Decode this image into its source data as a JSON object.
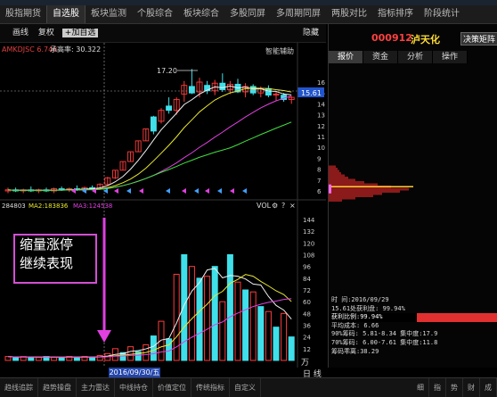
{
  "tabs": [
    {
      "label": "股指期货",
      "active": false
    },
    {
      "label": "自选股",
      "active": true
    },
    {
      "label": "板块监测",
      "active": false
    },
    {
      "label": "个股综合",
      "active": false
    },
    {
      "label": "板块综合",
      "active": false
    },
    {
      "label": "多股同屏",
      "active": false
    },
    {
      "label": "多周期同屏",
      "active": false
    },
    {
      "label": "两股对比",
      "active": false
    },
    {
      "label": "指标排序",
      "active": false
    },
    {
      "label": "阶段统计",
      "active": false
    }
  ],
  "toolbar": {
    "draw_label": "画线",
    "reset_label": "复权",
    "add_fav_label": "+加自选",
    "hide_label": "隐藏",
    "indicator_line": "AMKDJSC 6.746",
    "win_rate": "承高率: 30.322",
    "assist_label": "智能辅助"
  },
  "price_axis": {
    "ticks": [
      "16",
      "15",
      "14",
      "13",
      "12",
      "11",
      "10",
      "9",
      "8",
      "7",
      "6"
    ],
    "current_price": "15.61",
    "peak_label": "17.20"
  },
  "volume": {
    "vol_label": "VOL",
    "ma1": "284803",
    "ma2": "MA2:183836",
    "ma3": "MA3:124538",
    "ticks": [
      "144",
      "132",
      "120",
      "108",
      "96",
      "84",
      "72",
      "60",
      "48",
      "36",
      "24",
      "12"
    ],
    "unit_top": "万",
    "unit_bottom": "日 线"
  },
  "candles": [
    {
      "o": 6.0,
      "h": 6.3,
      "l": 5.8,
      "c": 6.1,
      "up": true
    },
    {
      "o": 6.1,
      "h": 6.3,
      "l": 5.9,
      "c": 6.0,
      "up": false
    },
    {
      "o": 6.0,
      "h": 6.2,
      "l": 5.8,
      "c": 6.1,
      "up": true
    },
    {
      "o": 6.1,
      "h": 6.4,
      "l": 5.9,
      "c": 6.0,
      "up": false
    },
    {
      "o": 6.0,
      "h": 6.2,
      "l": 5.8,
      "c": 6.1,
      "up": true
    },
    {
      "o": 6.1,
      "h": 6.3,
      "l": 5.9,
      "c": 6.0,
      "up": false
    },
    {
      "o": 6.0,
      "h": 6.3,
      "l": 5.8,
      "c": 6.2,
      "up": true
    },
    {
      "o": 6.2,
      "h": 6.4,
      "l": 6.0,
      "c": 6.1,
      "up": false
    },
    {
      "o": 6.1,
      "h": 6.3,
      "l": 5.9,
      "c": 6.2,
      "up": true
    },
    {
      "o": 6.2,
      "h": 6.5,
      "l": 6.0,
      "c": 6.1,
      "up": false
    },
    {
      "o": 6.1,
      "h": 6.4,
      "l": 6.0,
      "c": 6.3,
      "up": true
    },
    {
      "o": 6.3,
      "h": 6.5,
      "l": 6.1,
      "c": 6.2,
      "up": false
    },
    {
      "o": 6.2,
      "h": 6.7,
      "l": 6.1,
      "c": 6.6,
      "up": true
    },
    {
      "o": 6.6,
      "h": 7.3,
      "l": 6.5,
      "c": 7.2,
      "up": true
    },
    {
      "o": 7.2,
      "h": 7.9,
      "l": 7.1,
      "c": 7.9,
      "up": true
    },
    {
      "o": 7.9,
      "h": 8.7,
      "l": 7.9,
      "c": 8.7,
      "up": true
    },
    {
      "o": 8.7,
      "h": 9.6,
      "l": 8.7,
      "c": 9.6,
      "up": true
    },
    {
      "o": 9.6,
      "h": 10.6,
      "l": 9.6,
      "c": 10.6,
      "up": true
    },
    {
      "o": 10.6,
      "h": 11.7,
      "l": 10.6,
      "c": 11.7,
      "up": true
    },
    {
      "o": 11.5,
      "h": 12.9,
      "l": 11.2,
      "c": 12.8,
      "up": false
    },
    {
      "o": 12.4,
      "h": 13.6,
      "l": 12.2,
      "c": 13.4,
      "up": true
    },
    {
      "o": 13.8,
      "h": 14.6,
      "l": 13.1,
      "c": 13.4,
      "up": false
    },
    {
      "o": 13.4,
      "h": 14.6,
      "l": 13.0,
      "c": 14.4,
      "up": true
    },
    {
      "o": 14.9,
      "h": 16.1,
      "l": 14.2,
      "c": 15.7,
      "up": true
    },
    {
      "o": 15.6,
      "h": 17.2,
      "l": 14.9,
      "c": 15.0,
      "up": false
    },
    {
      "o": 15.1,
      "h": 16.4,
      "l": 14.6,
      "c": 16.0,
      "up": true
    },
    {
      "o": 15.7,
      "h": 16.1,
      "l": 14.9,
      "c": 15.2,
      "up": false
    },
    {
      "o": 15.2,
      "h": 16.2,
      "l": 14.8,
      "c": 15.9,
      "up": true
    },
    {
      "o": 15.9,
      "h": 16.8,
      "l": 15.1,
      "c": 15.3,
      "up": false
    },
    {
      "o": 15.3,
      "h": 16.1,
      "l": 14.9,
      "c": 15.8,
      "up": true
    },
    {
      "o": 15.8,
      "h": 16.3,
      "l": 15.0,
      "c": 15.1,
      "up": false
    },
    {
      "o": 15.1,
      "h": 15.9,
      "l": 14.6,
      "c": 15.6,
      "up": true
    },
    {
      "o": 15.6,
      "h": 15.8,
      "l": 14.8,
      "c": 15.0,
      "up": false
    },
    {
      "o": 15.0,
      "h": 15.6,
      "l": 14.6,
      "c": 15.4,
      "up": true
    },
    {
      "o": 15.4,
      "h": 15.7,
      "l": 14.6,
      "c": 14.8,
      "up": false
    },
    {
      "o": 14.8,
      "h": 15.1,
      "l": 14.3,
      "c": 14.9,
      "up": true
    },
    {
      "o": 14.8,
      "h": 15.0,
      "l": 14.2,
      "c": 14.4,
      "up": false
    },
    {
      "o": 14.4,
      "h": 14.7,
      "l": 14.0,
      "c": 14.6,
      "up": true
    }
  ],
  "volumes": [
    4,
    3,
    4,
    3,
    3,
    4,
    3,
    3,
    4,
    3,
    4,
    3,
    5,
    7,
    12,
    8,
    14,
    9,
    16,
    25,
    40,
    22,
    88,
    108,
    96,
    84,
    86,
    96,
    60,
    108,
    80,
    72,
    70,
    55,
    50,
    34,
    48,
    24
  ],
  "volume_color": [
    "r",
    "c",
    "r",
    "c",
    "r",
    "c",
    "r",
    "c",
    "r",
    "c",
    "r",
    "c",
    "r",
    "r",
    "r",
    "c",
    "r",
    "c",
    "r",
    "c",
    "r",
    "c",
    "r",
    "c",
    "r",
    "c",
    "r",
    "c",
    "r",
    "c",
    "r",
    "c",
    "r",
    "c",
    "r",
    "c",
    "r",
    "c"
  ],
  "stock": {
    "code": "000912",
    "name": "泸天化",
    "decision_btn": "决策矩阵"
  },
  "right_tabs": [
    {
      "label": "报价",
      "active": true
    },
    {
      "label": "资金",
      "active": false
    },
    {
      "label": "分析",
      "active": false
    },
    {
      "label": "操作",
      "active": false
    }
  ],
  "chip_axis": [
    "16",
    "14",
    "12",
    "10",
    "8",
    "6"
  ],
  "info": {
    "time_label": "时    间:2016/09/29",
    "profit_ratio_line": "15.61处获利盘: 99.94%",
    "profit_ratio": "获利比例:99.94%",
    "avg_cost": "平均成本: 6.66",
    "chip90": "90%筹码: 5.81-8.34  集中度:17.9",
    "chip70": "70%筹码: 6.00-7.61  集中度:11.8",
    "chip_conc": "筹码乖离:38.29"
  },
  "annotation": {
    "line1": "缩量涨停",
    "line2": "继续表现"
  },
  "date_label": "2016/09/30/五",
  "bottom_tabs": [
    "趋线追踪",
    "趋势操盘",
    "主力雷达",
    "中线持仓",
    "价值定位",
    "传统指标",
    "自定义"
  ],
  "bottom_right_tabs": [
    "细",
    "指",
    "势",
    "财",
    "成"
  ],
  "colors": {
    "up": "#ff3b3b",
    "down": "#3fe0ea",
    "ma5": "#f0f0f0",
    "ma10": "#e8e830",
    "ma20": "#e040e0",
    "ma30": "#40e040",
    "annot": "#d34fd3",
    "chip": "#8b1a1a"
  }
}
